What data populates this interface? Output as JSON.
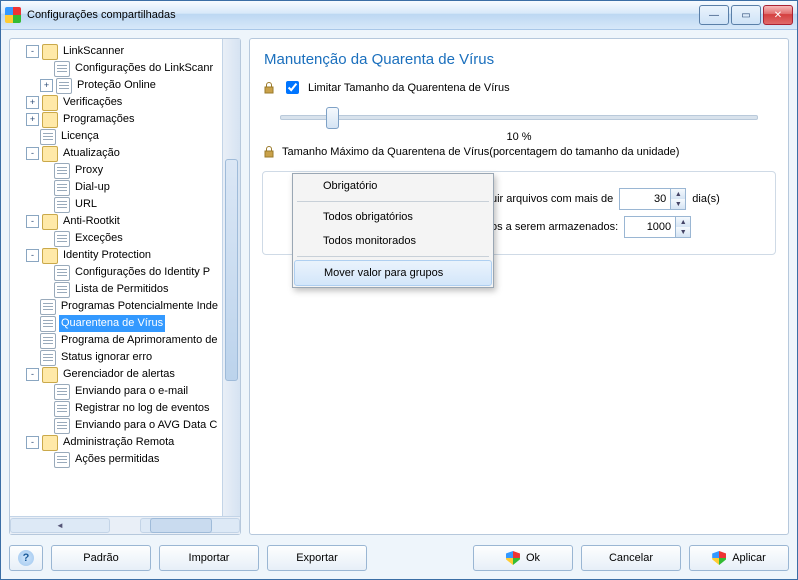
{
  "window": {
    "title": "Configurações compartilhadas"
  },
  "tree": [
    {
      "d": 1,
      "pm": "-",
      "i": "node",
      "t": "LinkScanner"
    },
    {
      "d": 2,
      "pm": " ",
      "i": "page",
      "t": "Configurações do LinkScanr"
    },
    {
      "d": 2,
      "pm": "+",
      "i": "page",
      "t": "Proteção Online"
    },
    {
      "d": 1,
      "pm": "+",
      "i": "node",
      "t": "Verificações"
    },
    {
      "d": 1,
      "pm": "+",
      "i": "node",
      "t": "Programações"
    },
    {
      "d": 1,
      "pm": " ",
      "i": "page",
      "t": "Licença"
    },
    {
      "d": 1,
      "pm": "-",
      "i": "node",
      "t": "Atualização"
    },
    {
      "d": 2,
      "pm": " ",
      "i": "page",
      "t": "Proxy"
    },
    {
      "d": 2,
      "pm": " ",
      "i": "page",
      "t": "Dial-up"
    },
    {
      "d": 2,
      "pm": " ",
      "i": "page",
      "t": "URL"
    },
    {
      "d": 1,
      "pm": "-",
      "i": "node",
      "t": "Anti-Rootkit"
    },
    {
      "d": 2,
      "pm": " ",
      "i": "page",
      "t": "Exceções"
    },
    {
      "d": 1,
      "pm": "-",
      "i": "node",
      "t": "Identity Protection"
    },
    {
      "d": 2,
      "pm": " ",
      "i": "page",
      "t": "Configurações do Identity P"
    },
    {
      "d": 2,
      "pm": " ",
      "i": "page",
      "t": "Lista de Permitidos"
    },
    {
      "d": 1,
      "pm": " ",
      "i": "page",
      "t": "Programas Potencialmente Inde"
    },
    {
      "d": 1,
      "pm": " ",
      "i": "page",
      "t": "Quarentena de Vírus",
      "sel": true
    },
    {
      "d": 1,
      "pm": " ",
      "i": "page",
      "t": "Programa de Aprimoramento de"
    },
    {
      "d": 1,
      "pm": " ",
      "i": "page",
      "t": "Status ignorar erro"
    },
    {
      "d": 1,
      "pm": "-",
      "i": "node",
      "t": "Gerenciador de alertas"
    },
    {
      "d": 2,
      "pm": " ",
      "i": "page",
      "t": "Enviando para o e-mail"
    },
    {
      "d": 2,
      "pm": " ",
      "i": "page",
      "t": "Registrar no log de eventos"
    },
    {
      "d": 2,
      "pm": " ",
      "i": "page",
      "t": "Enviando para o AVG Data C"
    },
    {
      "d": 1,
      "pm": "-",
      "i": "node",
      "t": "Administração Remota"
    },
    {
      "d": 2,
      "pm": " ",
      "i": "page",
      "t": "Ações permitidas"
    }
  ],
  "content": {
    "title": "Manutenção da Quarenta de Vírus",
    "limit_label": "Limitar Tamanho da Quarentena de Vírus",
    "limit_checked": true,
    "pct": "10 %",
    "max_label": "Tamanho Máximo da Quarentena de Vírus(porcentagem do tamanho da unidade)",
    "field1_tail": "uir arquivos com mais de",
    "field1_value": "30",
    "field1_unit": "dia(s)",
    "field2_tail": "os a serem armazenados:",
    "field2_value": "1000"
  },
  "context_menu": [
    "Obrigatório",
    "Todos obrigatórios",
    "Todos monitorados",
    "Mover valor para grupos"
  ],
  "footer": {
    "default": "Padrão",
    "import": "Importar",
    "export": "Exportar",
    "ok": "Ok",
    "cancel": "Cancelar",
    "apply": "Aplicar"
  }
}
